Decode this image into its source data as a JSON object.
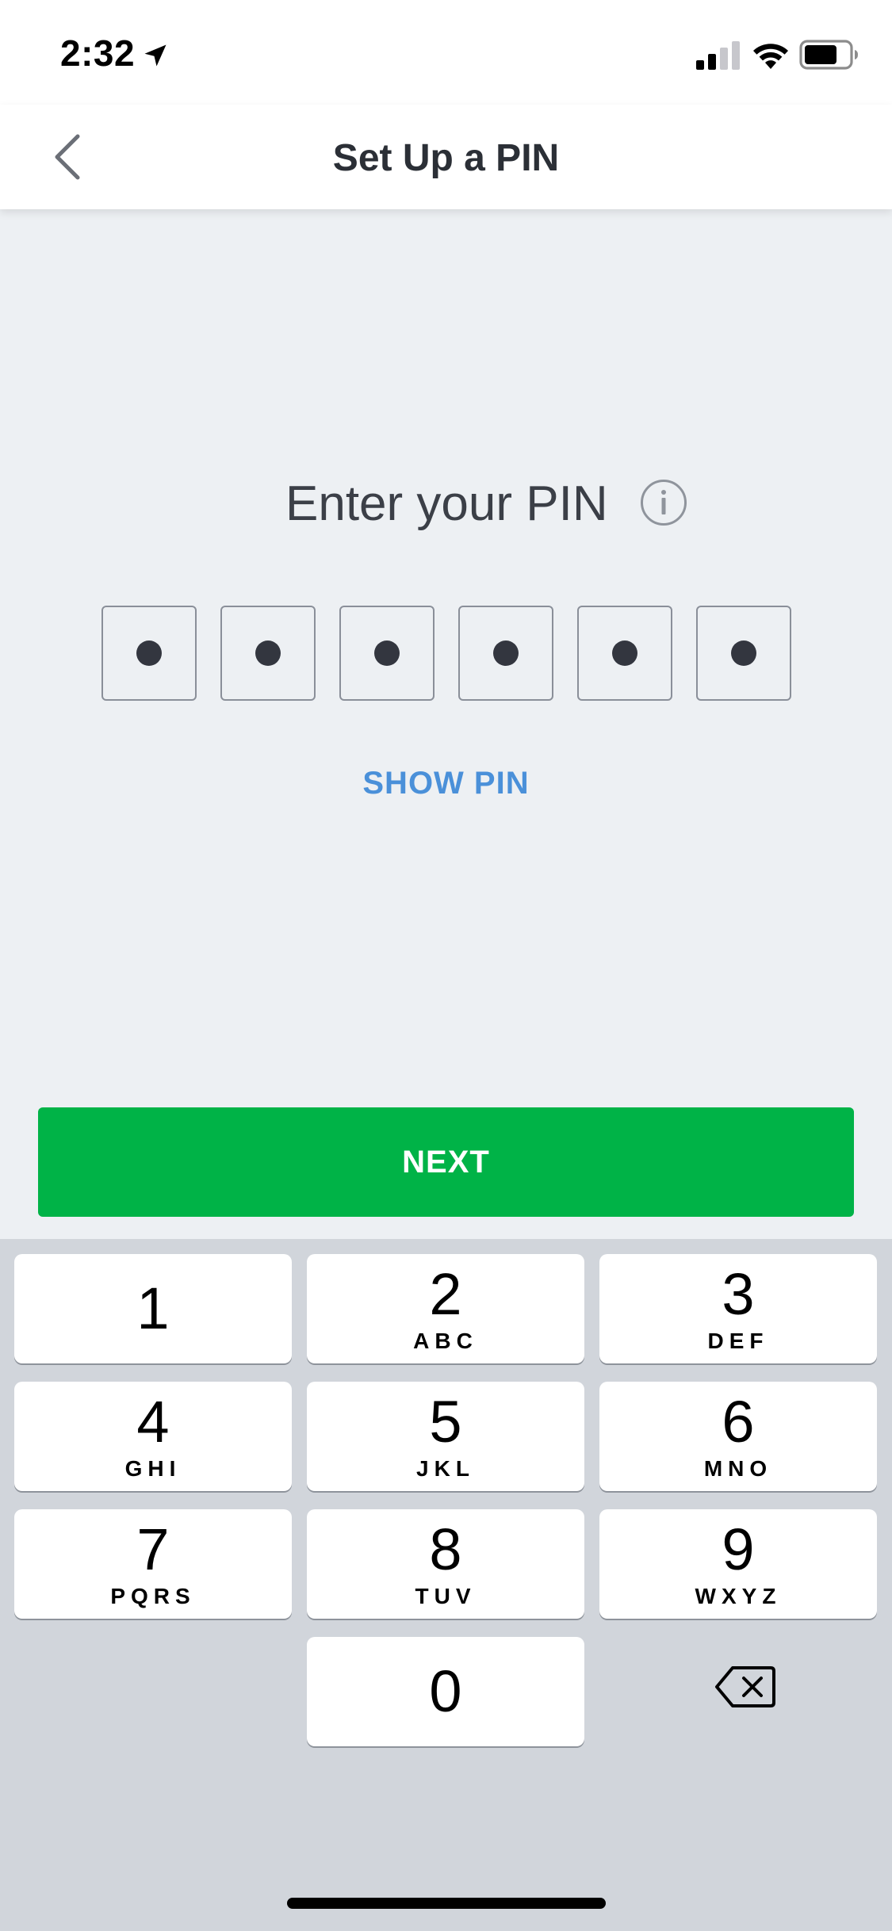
{
  "status_bar": {
    "time": "2:32",
    "icons": [
      "location-arrow-icon",
      "cellular-signal-icon",
      "wifi-icon",
      "battery-icon"
    ]
  },
  "header": {
    "title": "Set Up a PIN",
    "back_icon": "chevron-left-icon"
  },
  "pin_entry": {
    "label": "Enter your PIN",
    "info_icon": "info-icon",
    "digit_count": 6,
    "filled_count": 6,
    "show_pin_label": "SHOW PIN"
  },
  "actions": {
    "next_label": "NEXT"
  },
  "keypad": {
    "keys": [
      {
        "digit": "1",
        "letters": ""
      },
      {
        "digit": "2",
        "letters": "ABC"
      },
      {
        "digit": "3",
        "letters": "DEF"
      },
      {
        "digit": "4",
        "letters": "GHI"
      },
      {
        "digit": "5",
        "letters": "JKL"
      },
      {
        "digit": "6",
        "letters": "MNO"
      },
      {
        "digit": "7",
        "letters": "PQRS"
      },
      {
        "digit": "8",
        "letters": "TUV"
      },
      {
        "digit": "9",
        "letters": "WXYZ"
      },
      {
        "digit": "0",
        "letters": ""
      }
    ],
    "backspace_icon": "backspace-icon"
  },
  "colors": {
    "background": "#edf0f3",
    "primary_button": "#00b347",
    "link": "#4a90d9",
    "keypad_background": "#d1d5db"
  }
}
